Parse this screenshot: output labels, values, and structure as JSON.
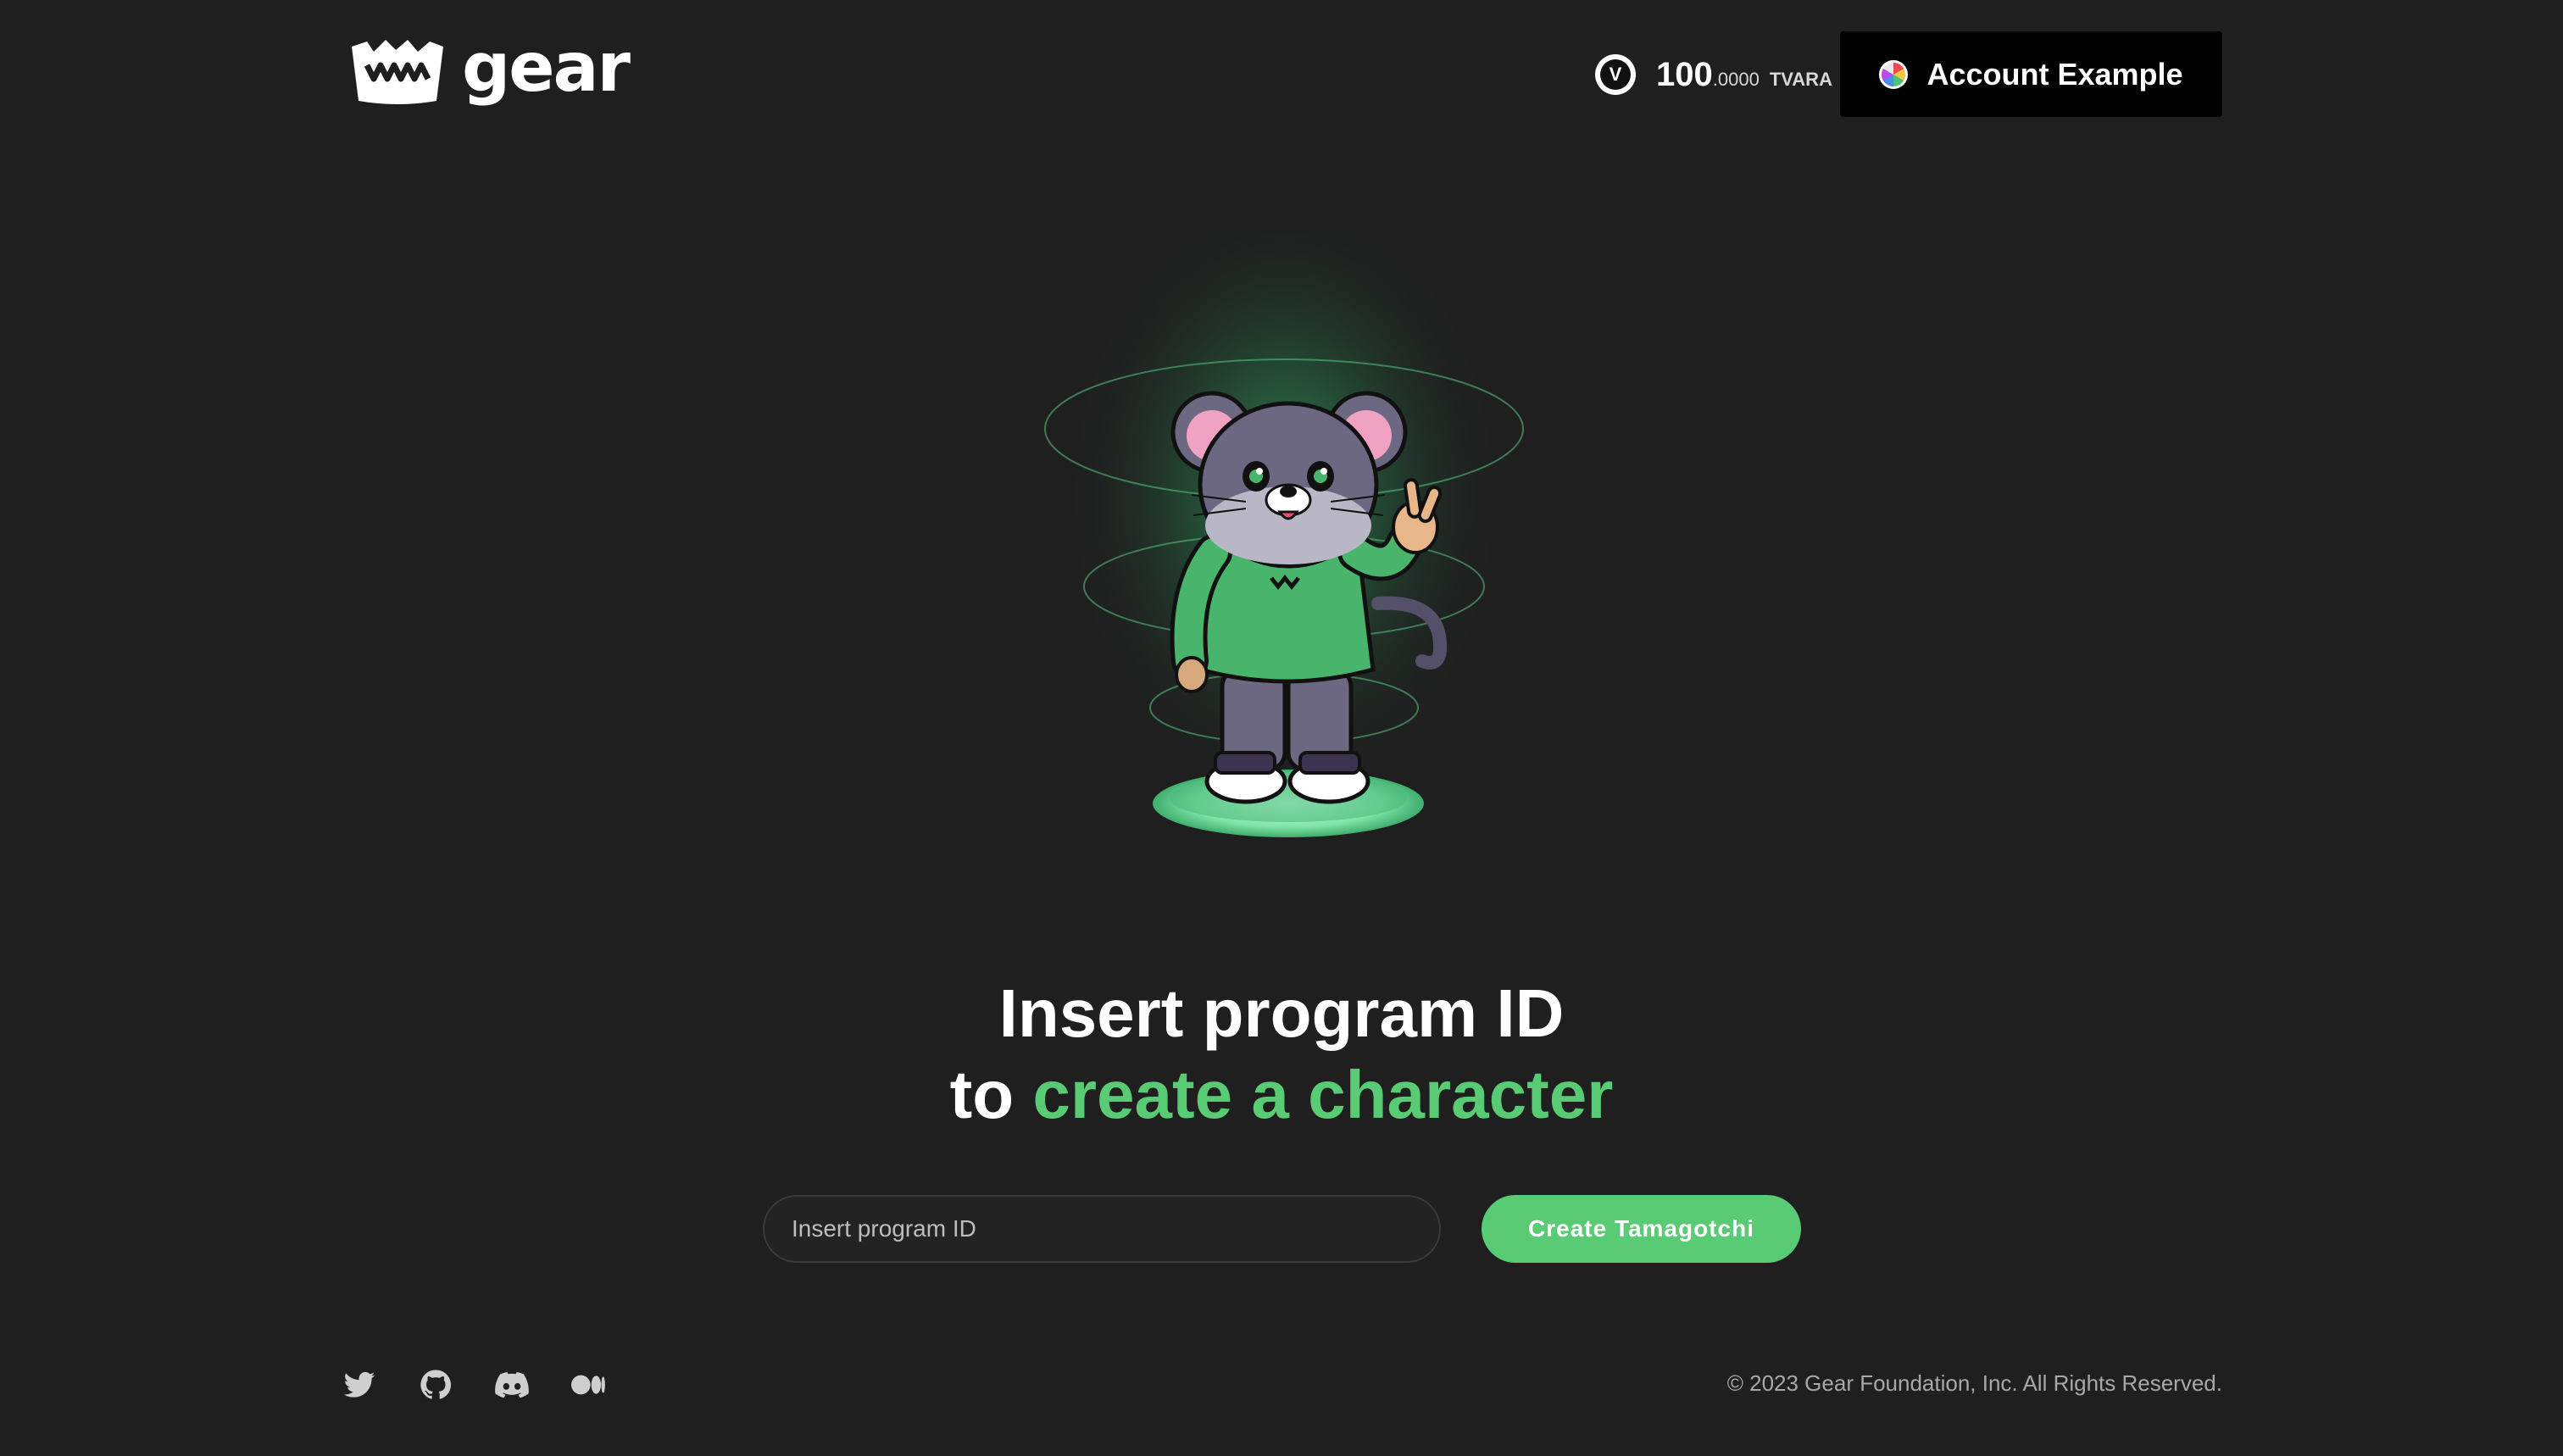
{
  "header": {
    "logo_text": "gear",
    "balance": {
      "icon": "vara-token-icon",
      "integer": "100",
      "decimals": ".0000",
      "unit": "TVARA"
    },
    "account": {
      "avatar": "identicon-avatar",
      "label": "Account Example"
    }
  },
  "hero": {
    "image": "tamagotchi-mouse-character",
    "title_line1": "Insert program ID",
    "title_line2_prefix": "to",
    "title_line2_accent": "create a character"
  },
  "form": {
    "program_id_placeholder": "Insert program ID",
    "program_id_value": "",
    "submit_label": "Create Tamagotchi"
  },
  "footer": {
    "socials": [
      {
        "icon": "twitter-icon"
      },
      {
        "icon": "github-icon"
      },
      {
        "icon": "discord-icon"
      },
      {
        "icon": "medium-icon"
      }
    ],
    "copyright": "© 2023 Gear Foundation, Inc. All Rights Reserved."
  },
  "colors": {
    "background": "#1f1f1f",
    "accent": "#5acb75",
    "account_button": "#000000"
  }
}
